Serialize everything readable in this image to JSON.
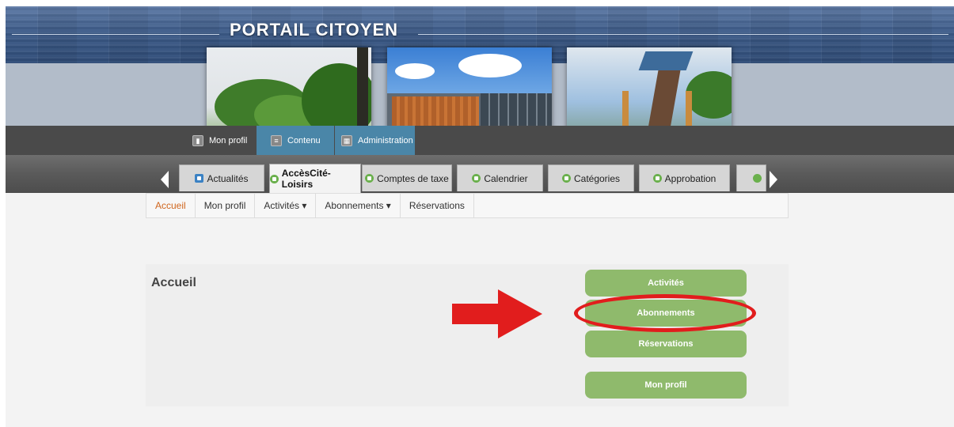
{
  "header": {
    "title": "PORTAIL CITOYEN"
  },
  "user_menu": [
    {
      "label": "Mon profil",
      "icon": "user-icon",
      "active": false
    },
    {
      "label": "Contenu",
      "icon": "document-icon",
      "active": true
    },
    {
      "label": "Administration",
      "icon": "admin-icon",
      "active": true
    }
  ],
  "tabs": [
    {
      "label": "Actualités",
      "icon": "home-icon"
    },
    {
      "label": "AccèsCité-Loisirs",
      "icon": "app-icon",
      "active": true
    },
    {
      "label": "Comptes de taxe",
      "icon": "app-icon"
    },
    {
      "label": "Calendrier",
      "icon": "app-icon"
    },
    {
      "label": "Catégories",
      "icon": "app-icon"
    },
    {
      "label": "Approbation",
      "icon": "app-icon"
    }
  ],
  "submenu": [
    {
      "label": "Accueil",
      "active": true
    },
    {
      "label": "Mon profil"
    },
    {
      "label": "Activités ▾"
    },
    {
      "label": "Abonnements ▾"
    },
    {
      "label": "Réservations"
    }
  ],
  "main": {
    "title": "Accueil",
    "buttons": {
      "activites": "Activités",
      "abonnements": "Abonnements",
      "reservations": "Réservations",
      "mon_profil": "Mon profil"
    }
  },
  "colors": {
    "accent_green": "#8fba6c",
    "active_submenu": "#d0661e",
    "annotation_red": "#e11d1d",
    "usermenu_active": "#4a86a8"
  }
}
